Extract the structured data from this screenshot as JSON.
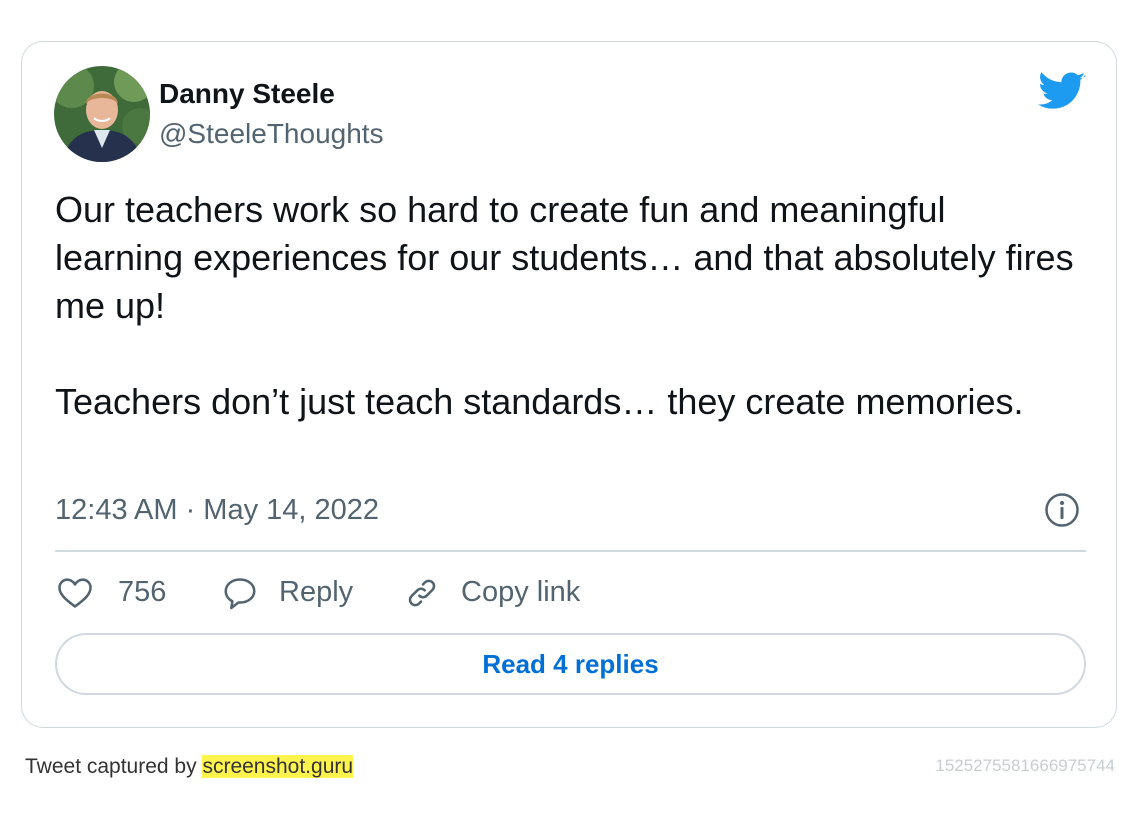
{
  "tweet": {
    "author": {
      "display_name": "Danny Steele",
      "handle": "@SteeleThoughts"
    },
    "text_paragraphs": [
      "Our teachers work so hard to create fun and meaningful learning experiences for our students… and that absolutely fires me up!",
      "Teachers don’t just teach standards… they create memories."
    ],
    "timestamp": "12:43 AM · May 14, 2022",
    "actions": {
      "like_count": "756",
      "reply_label": "Reply",
      "copy_link_label": "Copy link"
    },
    "read_replies_label": "Read 4 replies"
  },
  "footer": {
    "captured_prefix": "Tweet captured by",
    "captured_site": "screenshot.guru",
    "tweet_id": "1525275581666975744"
  },
  "icons": {
    "brand": "twitter-bird-icon",
    "info": "info-icon",
    "like": "heart-icon",
    "reply": "speech-bubble-icon",
    "copy_link": "link-icon"
  },
  "colors": {
    "twitter_blue": "#1d9bf0",
    "link_blue": "#006fd6",
    "muted_text": "#536471",
    "border": "#cfd9de",
    "highlight": "#fff34d"
  }
}
